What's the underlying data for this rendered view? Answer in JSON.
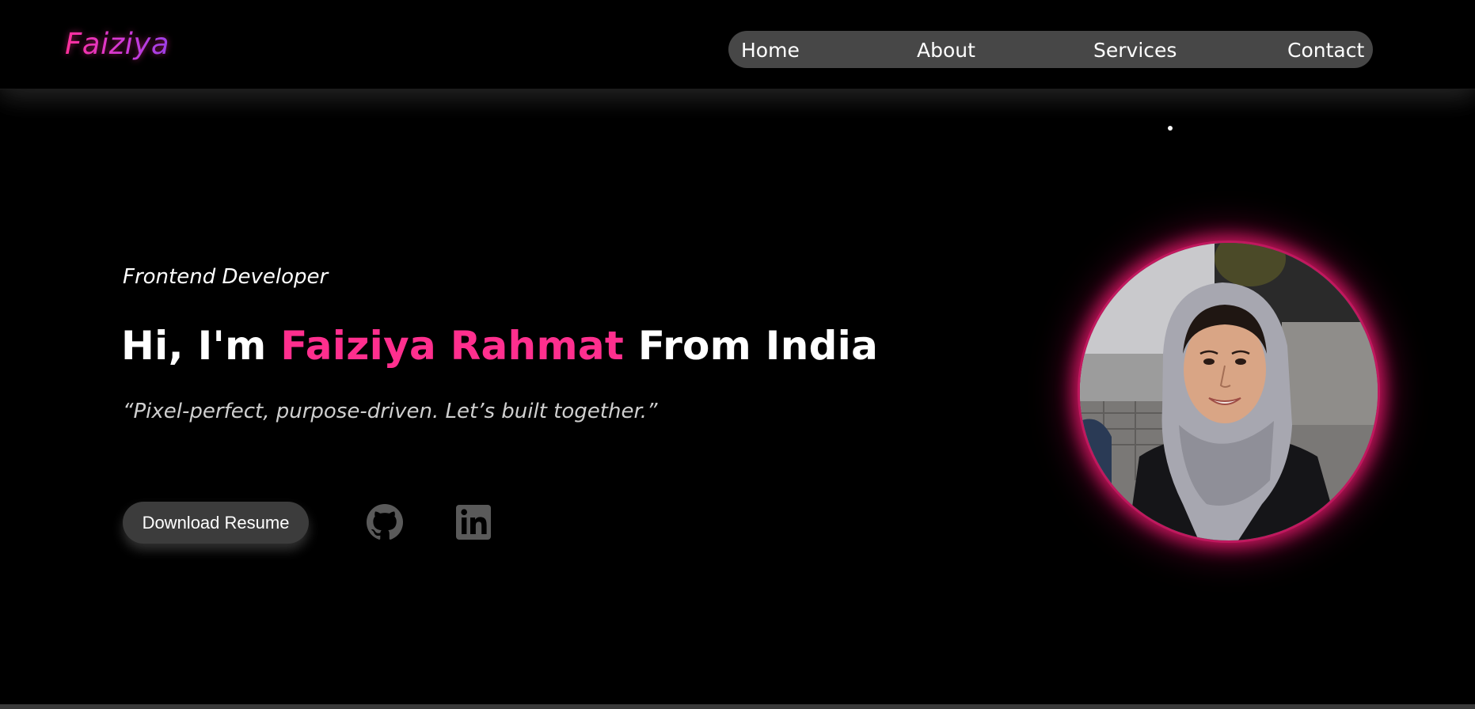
{
  "header": {
    "logo": "Faiziya",
    "nav": [
      {
        "label": "Home"
      },
      {
        "label": "About"
      },
      {
        "label": "Services"
      },
      {
        "label": "Contact"
      }
    ]
  },
  "hero": {
    "role": "Frontend Developer",
    "greeting": "Hi, I'm",
    "name": "Faiziya Rahmat",
    "origin": "From India",
    "tagline": "“Pixel-perfect, purpose-driven. Let’s built together.”",
    "resume_button": "Download Resume",
    "social": [
      {
        "icon": "github-icon"
      },
      {
        "icon": "linkedin-icon"
      }
    ]
  },
  "colors": {
    "accent": "#ff2f8e",
    "background": "#000000",
    "nav_bg": "#474747",
    "button_bg": "#3c3c3c"
  }
}
